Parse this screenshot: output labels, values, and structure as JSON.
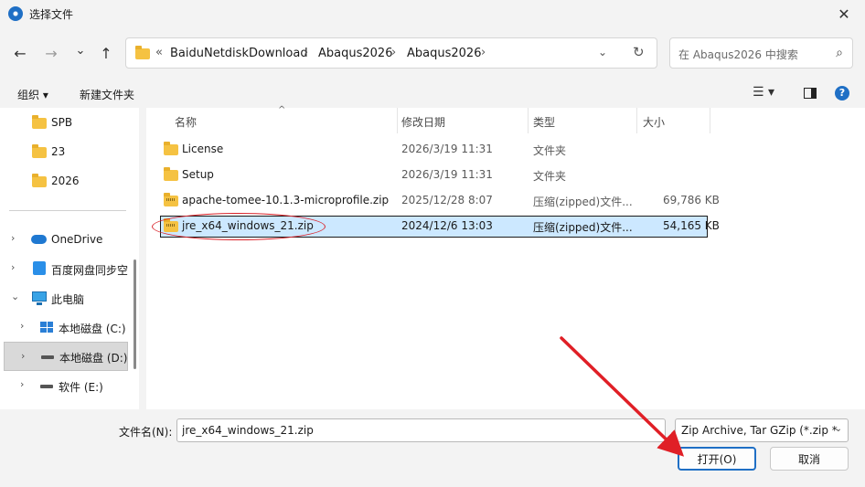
{
  "window": {
    "title": "选择文件",
    "close_glyph": "✕",
    "app_icon": "baidunetdisk-app-icon"
  },
  "nav": {
    "back_glyph": "←",
    "forward_glyph": "→",
    "recent_glyph": "⌄",
    "up_glyph": "↑"
  },
  "address": {
    "overflow": "«",
    "segments": [
      "BaiduNetdiskDownload",
      "Abaqus2026",
      "Abaqus2026"
    ],
    "sep": "›",
    "dropdown_glyph": "⌄",
    "refresh_glyph": "↻"
  },
  "search": {
    "placeholder": "在 Abaqus2026 中搜索",
    "icon_glyph": "⌕"
  },
  "toolbar": {
    "organize": "组织 ▾",
    "new_folder": "新建文件夹",
    "view_glyph": "☰ ▾",
    "help_glyph": "?"
  },
  "sidebar": {
    "items": [
      {
        "label": "SPB"
      },
      {
        "label": "23"
      },
      {
        "label": "2026"
      },
      {
        "label": "OneDrive"
      },
      {
        "label": "百度网盘同步空"
      },
      {
        "label": "此电脑"
      },
      {
        "label": "本地磁盘 (C:)"
      },
      {
        "label": "本地磁盘 (D:)"
      },
      {
        "label": "软件 (E:)"
      }
    ],
    "collapsed_glyph": "›",
    "expanded_glyph": "⌄"
  },
  "columns": {
    "name": "名称",
    "date": "修改日期",
    "type": "类型",
    "size": "大小",
    "sort_glyph": "^"
  },
  "files": [
    {
      "name": "License",
      "date": "2026/3/19 11:31",
      "type": "文件夹",
      "size": ""
    },
    {
      "name": "Setup",
      "date": "2026/3/19 11:31",
      "type": "文件夹",
      "size": ""
    },
    {
      "name": "apache-tomee-10.1.3-microprofile.zip",
      "date": "2025/12/28 8:07",
      "type": "压缩(zipped)文件...",
      "size": "69,786 KB"
    },
    {
      "name": "jre_x64_windows_21.zip",
      "date": "2024/12/6 13:03",
      "type": "压缩(zipped)文件...",
      "size": "54,165 KB"
    }
  ],
  "bottom": {
    "filename_label": "文件名(N):",
    "filename_value": "jre_x64_windows_21.zip",
    "filter_value": "Zip Archive, Tar GZip (*.zip *",
    "filter_chevron": "⌄",
    "open_label": "打开(O)",
    "cancel_label": "取消"
  },
  "colors": {
    "accent": "#1f6fc5",
    "annotation": "#d9232a",
    "selection": "#cce8ff"
  }
}
